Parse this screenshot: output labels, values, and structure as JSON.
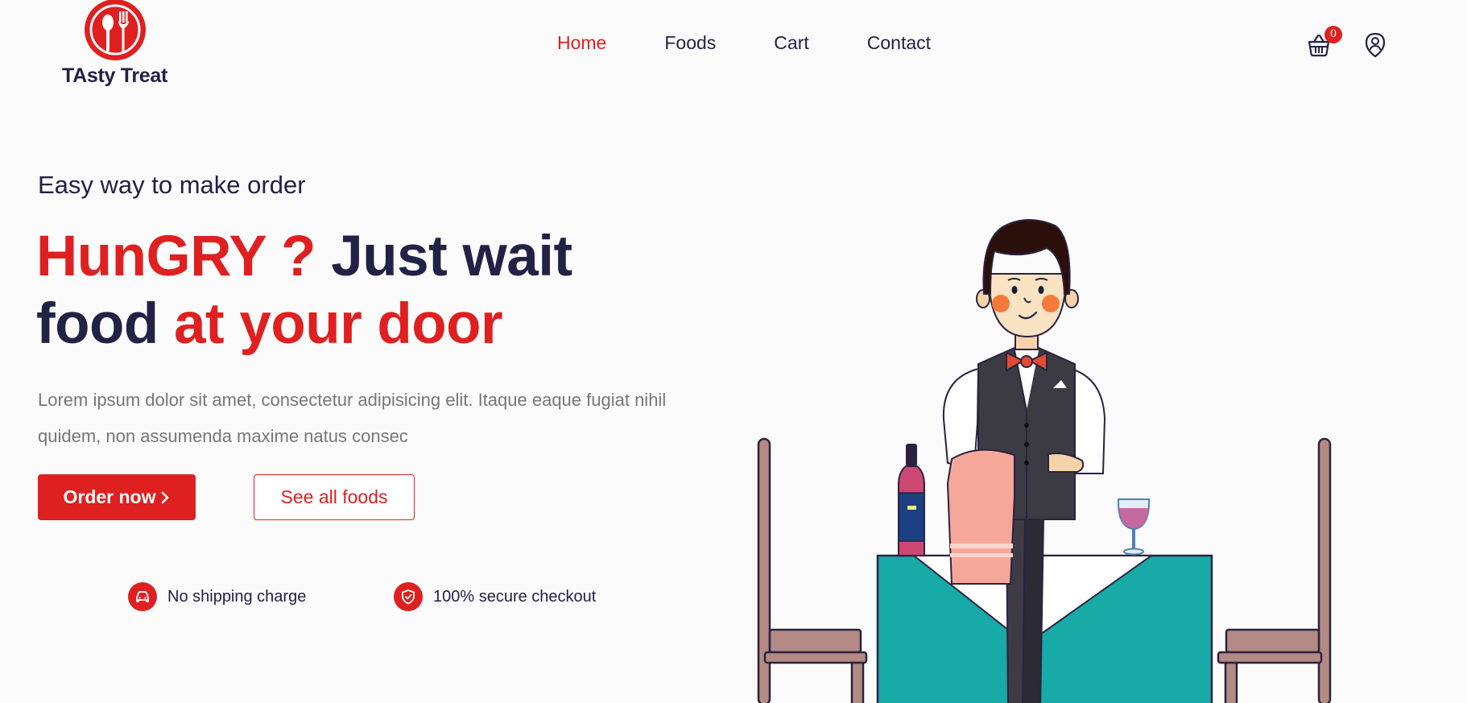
{
  "brand": {
    "name": "TAsty Treat",
    "logo_icon": "spoon-fork-icon",
    "accent_color": "#df2020",
    "text_color": "#212245"
  },
  "nav": {
    "items": [
      {
        "label": "Home",
        "active": true
      },
      {
        "label": "Foods",
        "active": false
      },
      {
        "label": "Cart",
        "active": false
      },
      {
        "label": "Contact",
        "active": false
      }
    ],
    "cart_count": "0",
    "cart_icon": "shopping-basket-icon",
    "user_icon": "user-icon"
  },
  "hero": {
    "subtitle": "Easy way to make order",
    "title_part1": "HunGRY ?",
    "title_part2": " Just wait",
    "title_part3": "food",
    "title_part4": " at your door",
    "description": "Lorem ipsum dolor sit amet, consectetur adipisicing elit. Itaque eaque fugiat nihil quidem, non assumenda maxime natus consec",
    "order_button": "Order now",
    "all_foods_button": "See all foods"
  },
  "features": [
    {
      "label": "No shipping charge",
      "icon": "car-icon"
    },
    {
      "label": "100% secure checkout",
      "icon": "shield-check-icon"
    }
  ]
}
